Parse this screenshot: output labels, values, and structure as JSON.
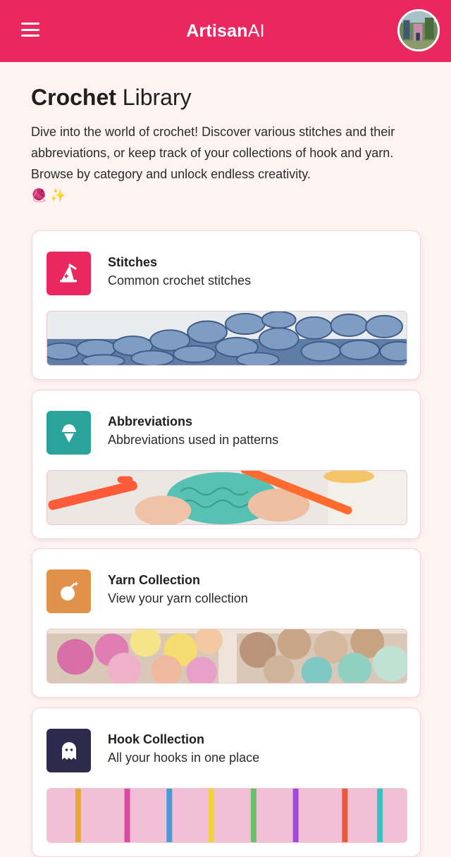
{
  "header": {
    "brand_bold": "Artisan",
    "brand_light": "AI",
    "background": "#e8285f",
    "menu_icon": "hamburger-menu-icon",
    "avatar_icon": "user-avatar"
  },
  "page": {
    "title_bold": "Crochet",
    "title_light": "Library",
    "intro": "Dive into the world of crochet! Discover various stitches and their abbreviations, or keep track of your collections of hook and yarn. Browse by category and unlock endless creativity.",
    "intro_emoji": "🧶 ✨"
  },
  "cards": [
    {
      "title": "Stitches",
      "subtitle": "Common crochet stitches",
      "icon": "wizard-hat-icon",
      "color": "#e8285f"
    },
    {
      "title": "Abbreviations",
      "subtitle": "Abbreviations used in patterns",
      "icon": "ice-cream-icon",
      "color": "#2aa39a"
    },
    {
      "title": "Yarn Collection",
      "subtitle": "View your yarn collection",
      "icon": "bomb-sparkle-icon",
      "color": "#e0924a"
    },
    {
      "title": "Hook Collection",
      "subtitle": "All your hooks in one place",
      "icon": "ghost-icon",
      "color": "#2e2a4e"
    }
  ]
}
